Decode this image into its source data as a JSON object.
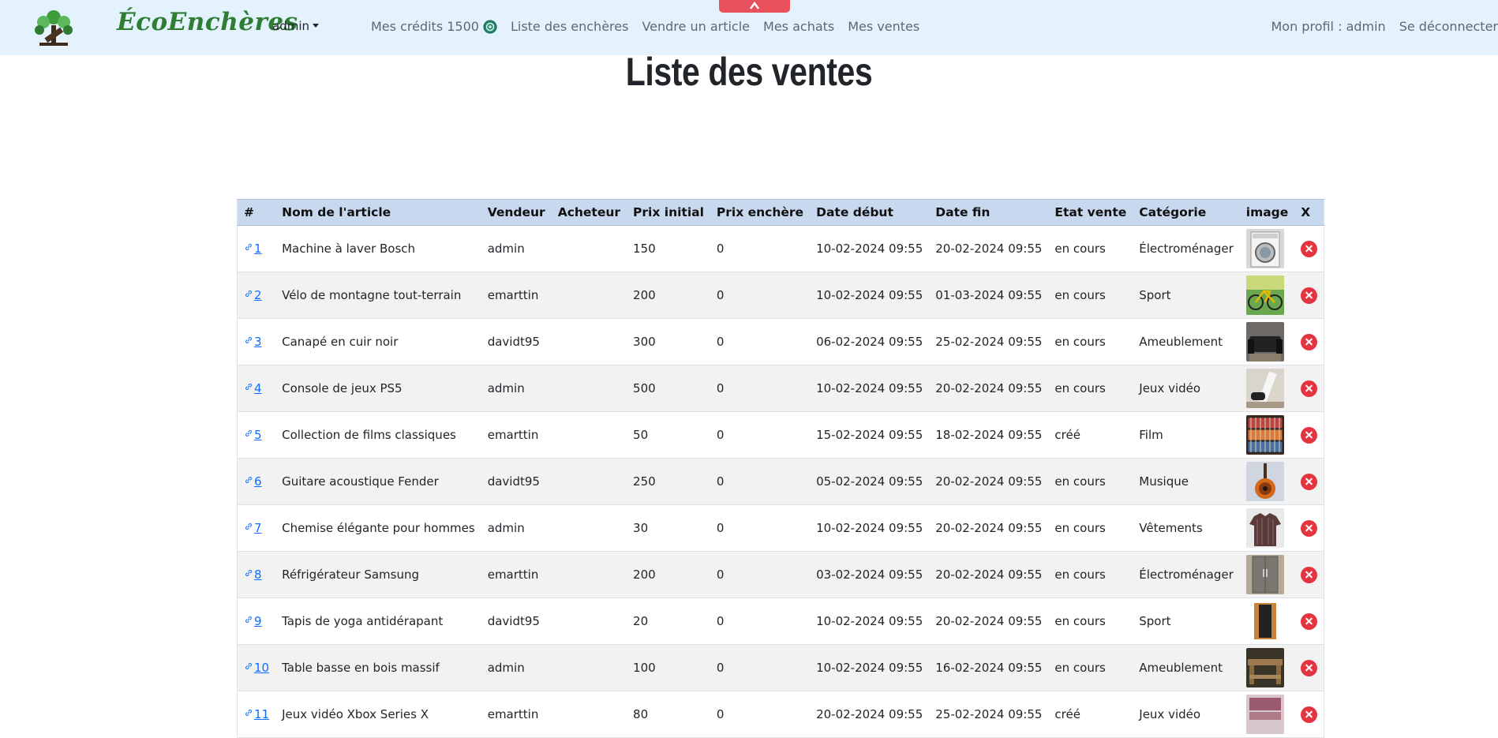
{
  "brand": {
    "name": "ÉcoEnchères"
  },
  "nav": {
    "user_menu": "admin",
    "credits_label": "Mes crédits 1500",
    "auctions_list": "Liste des enchères",
    "sell_item": "Vendre un article",
    "my_purchases": "Mes achats",
    "my_sales": "Mes ventes",
    "profile": "Mon profil : admin",
    "logout": "Se déconnecter"
  },
  "page": {
    "title": "Liste des ventes"
  },
  "table": {
    "headers": [
      "#",
      "Nom de l'article",
      "Vendeur",
      "Acheteur",
      "Prix initial",
      "Prix enchère",
      "Date début",
      "Date fin",
      "Etat vente",
      "Catégorie",
      "image",
      "X"
    ],
    "rows": [
      {
        "id": "1",
        "name": "Machine à laver Bosch",
        "seller": "admin",
        "buyer": "",
        "initial": "150",
        "bid": "0",
        "start": "10-02-2024 09:55",
        "end": "20-02-2024 09:55",
        "state": "en cours",
        "category": "Électroménager",
        "image": "washing-machine"
      },
      {
        "id": "2",
        "name": "Vélo de montagne tout-terrain",
        "seller": "emarttin",
        "buyer": "",
        "initial": "200",
        "bid": "0",
        "start": "10-02-2024 09:55",
        "end": "01-03-2024 09:55",
        "state": "en cours",
        "category": "Sport",
        "image": "bike"
      },
      {
        "id": "3",
        "name": "Canapé en cuir noir",
        "seller": "davidt95",
        "buyer": "",
        "initial": "300",
        "bid": "0",
        "start": "06-02-2024 09:55",
        "end": "25-02-2024 09:55",
        "state": "en cours",
        "category": "Ameublement",
        "image": "sofa"
      },
      {
        "id": "4",
        "name": "Console de jeux PS5",
        "seller": "admin",
        "buyer": "",
        "initial": "500",
        "bid": "0",
        "start": "10-02-2024 09:55",
        "end": "20-02-2024 09:55",
        "state": "en cours",
        "category": "Jeux vidéo",
        "image": "console"
      },
      {
        "id": "5",
        "name": "Collection de films classiques",
        "seller": "emarttin",
        "buyer": "",
        "initial": "50",
        "bid": "0",
        "start": "15-02-2024 09:55",
        "end": "18-02-2024 09:55",
        "state": "créé",
        "category": "Film",
        "image": "films"
      },
      {
        "id": "6",
        "name": "Guitare acoustique Fender",
        "seller": "davidt95",
        "buyer": "",
        "initial": "250",
        "bid": "0",
        "start": "05-02-2024 09:55",
        "end": "20-02-2024 09:55",
        "state": "en cours",
        "category": "Musique",
        "image": "guitar"
      },
      {
        "id": "7",
        "name": "Chemise élégante pour hommes",
        "seller": "admin",
        "buyer": "",
        "initial": "30",
        "bid": "0",
        "start": "10-02-2024 09:55",
        "end": "20-02-2024 09:55",
        "state": "en cours",
        "category": "Vêtements",
        "image": "shirt"
      },
      {
        "id": "8",
        "name": "Réfrigérateur Samsung",
        "seller": "emarttin",
        "buyer": "",
        "initial": "200",
        "bid": "0",
        "start": "03-02-2024 09:55",
        "end": "20-02-2024 09:55",
        "state": "en cours",
        "category": "Électroménager",
        "image": "fridge"
      },
      {
        "id": "9",
        "name": "Tapis de yoga antidérapant",
        "seller": "davidt95",
        "buyer": "",
        "initial": "20",
        "bid": "0",
        "start": "10-02-2024 09:55",
        "end": "20-02-2024 09:55",
        "state": "en cours",
        "category": "Sport",
        "image": "yoga-mat"
      },
      {
        "id": "10",
        "name": "Table basse en bois massif",
        "seller": "admin",
        "buyer": "",
        "initial": "100",
        "bid": "0",
        "start": "10-02-2024 09:55",
        "end": "16-02-2024 09:55",
        "state": "en cours",
        "category": "Ameublement",
        "image": "coffee-table"
      },
      {
        "id": "11",
        "name": "Jeux vidéo Xbox Series X",
        "seller": "emarttin",
        "buyer": "",
        "initial": "80",
        "bid": "0",
        "start": "20-02-2024 09:55",
        "end": "25-02-2024 09:55",
        "state": "créé",
        "category": "Jeux vidéo",
        "image": "xbox-games"
      }
    ]
  },
  "colors": {
    "navbar_bg": "#e3f2fd",
    "brand": "#2e7d32",
    "link": "#0d6efd",
    "delete": "#e4343f",
    "header_bg": "#c7d8ef"
  }
}
